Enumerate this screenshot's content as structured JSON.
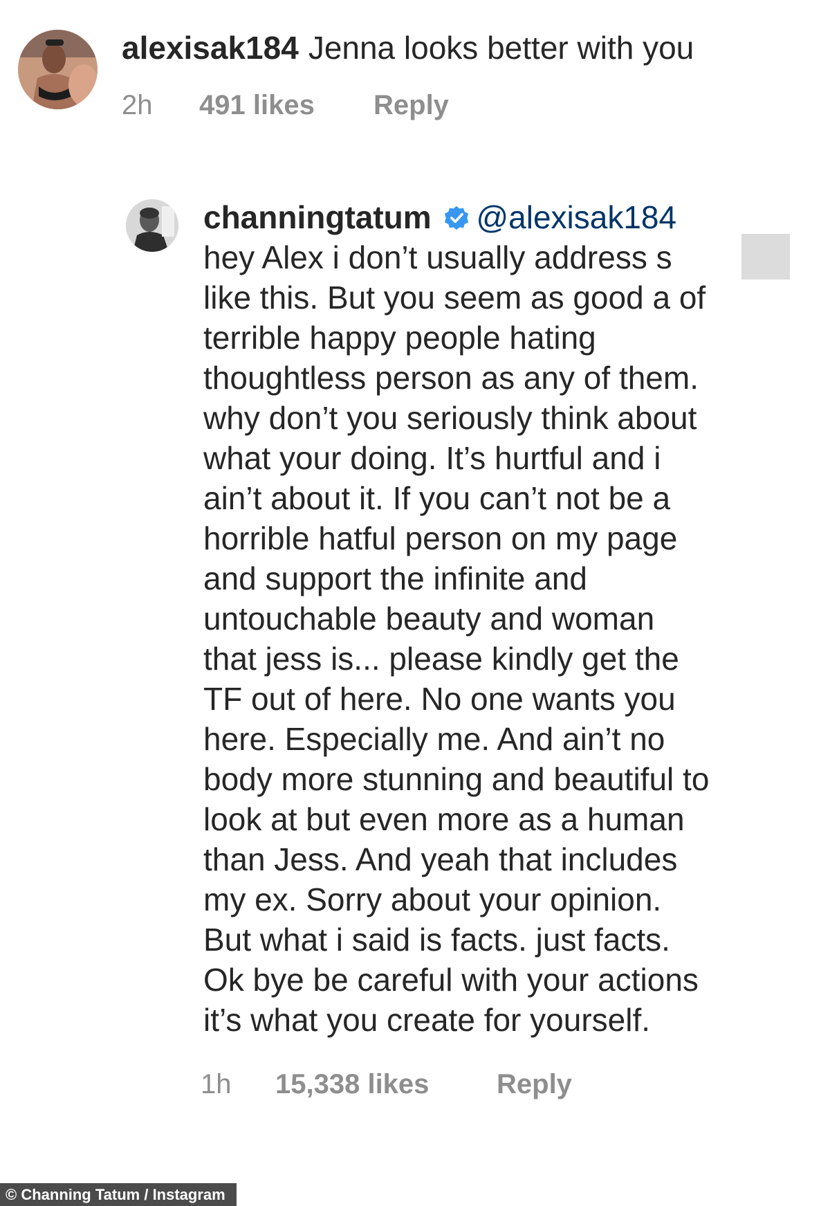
{
  "comment_1": {
    "username": "alexisak184",
    "text": "Jenna looks better with you",
    "time": "2h",
    "likes": "491 likes",
    "reply_label": "Reply"
  },
  "comment_2": {
    "username": "channingtatum",
    "verified": true,
    "mention": "@alexisak184",
    "lines": [
      "hey Alex i don’t usually address s",
      "like this. But you seem as good a of",
      "terrible happy people hating",
      "thoughtless person as any of them.",
      "why don’t you seriously think about",
      "what your doing. It’s hurtful and i",
      "ain’t about it. If you can’t not be a",
      "horrible hatful person on my page",
      "and support the infinite and",
      "untouchable beauty and woman",
      "that jess is... please kindly get the",
      "TF out of here. No one wants you",
      "here. Especially me. And ain’t no",
      "body more stunning and beautiful to",
      "look at but even more as a human",
      "than Jess. And yeah that includes",
      "my ex. Sorry about your opinion.",
      "But what i said is facts. just facts.",
      "Ok bye be careful with your actions",
      "it’s what you create for yourself."
    ],
    "time": "1h",
    "likes": "15,338 likes",
    "reply_label": "Reply"
  },
  "credit": "© Channing Tatum / Instagram",
  "colors": {
    "text": "#262626",
    "meta": "#8e8e8e",
    "mention": "#003569",
    "verified": "#3897f0"
  }
}
